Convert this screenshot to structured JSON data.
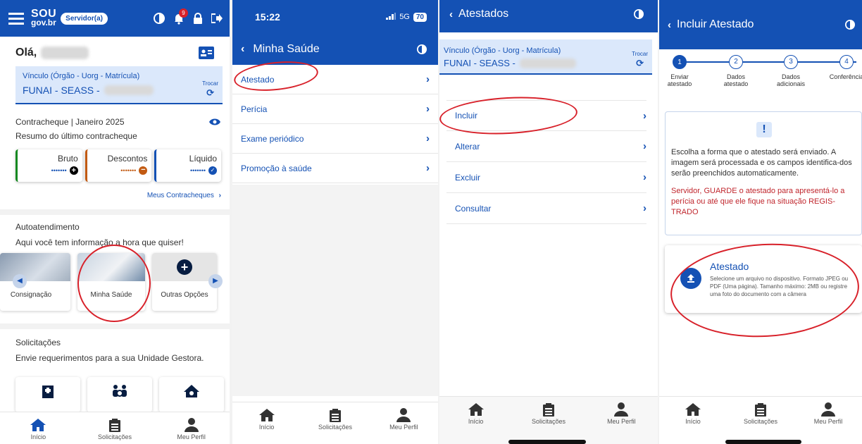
{
  "panel1": {
    "header": {
      "logo_top": "SOU",
      "logo_bottom": "gov.br",
      "badge": "Servidor(a)",
      "notif_count": "9"
    },
    "greeting": "Olá,",
    "vinculo": {
      "label": "Vínculo (Órgão - Uorg - Matrícula)",
      "value": "FUNAI - SEASS -",
      "trocar": "Trocar"
    },
    "contracheque": {
      "title": "Contracheque | Janeiro 2025",
      "subtitle": "Resumo do último contracheque",
      "cards": [
        {
          "label": "Bruto",
          "masked": "•••••••"
        },
        {
          "label": "Descontos",
          "masked": "•••••••"
        },
        {
          "label": "Líquido",
          "masked": "•••••••"
        }
      ],
      "link": "Meus Contracheques"
    },
    "autoatendimento": {
      "title": "Autoatendimento",
      "subtitle": "Aqui você tem informação a hora que quiser!",
      "cards": [
        "Consignação",
        "Minha Saúde",
        "Outras Opções"
      ]
    },
    "solicitacoes": {
      "title": "Solicitações",
      "subtitle": "Envie requerimentos para a sua Unidade Gestora."
    },
    "tabs": [
      "Início",
      "Solicitações",
      "Meu Perfil"
    ]
  },
  "panel2": {
    "status": {
      "time": "15:22",
      "network": "5G",
      "battery": "70"
    },
    "title": "Minha Saúde",
    "items": [
      "Atestado",
      "Perícia",
      "Exame periódico",
      "Promoção à saúde"
    ],
    "tabs": [
      "Início",
      "Solicitações",
      "Meu Perfil"
    ]
  },
  "panel3": {
    "title": "Atestados",
    "vinculo": {
      "label": "Vínculo (Órgão - Uorg - Matrícula)",
      "value": "FUNAI - SEASS -",
      "trocar": "Trocar"
    },
    "items": [
      "Incluir",
      "Alterar",
      "Excluir",
      "Consultar"
    ],
    "tabs": [
      "Início",
      "Solicitações",
      "Meu Perfil"
    ]
  },
  "panel4": {
    "title": "Incluir Atestado",
    "steps": [
      {
        "num": "1",
        "label1": "Enviar",
        "label2": "atestado"
      },
      {
        "num": "2",
        "label1": "Dados",
        "label2": "atestado"
      },
      {
        "num": "3",
        "label1": "Dados",
        "label2": "adicionais"
      },
      {
        "num": "4",
        "label1": "Conferência",
        "label2": ""
      }
    ],
    "info": {
      "text": "Escolha a forma que o atestado será enviado. A imagem será processada e os campos identifica-dos serão preenchidos automaticamente.",
      "warning": "Servidor, GUARDE o atestado para apresentá-lo a perícia ou até que ele fique na situação REGIS-TRADO"
    },
    "upload": {
      "title": "Atestado",
      "text": "Selecione um arquivo no dispositivo. Formato JPEG ou PDF (Uma página). Tamanho máximo: 2MB ou registre uma foto do documento com a câmera"
    },
    "tabs": [
      "Início",
      "Solicitações",
      "Meu Perfil"
    ]
  },
  "colors": {
    "primary": "#1451b4",
    "red_annotation": "#d8212a",
    "warning_text": "#c0262d",
    "green": "#168821",
    "orange": "#c25a12"
  }
}
